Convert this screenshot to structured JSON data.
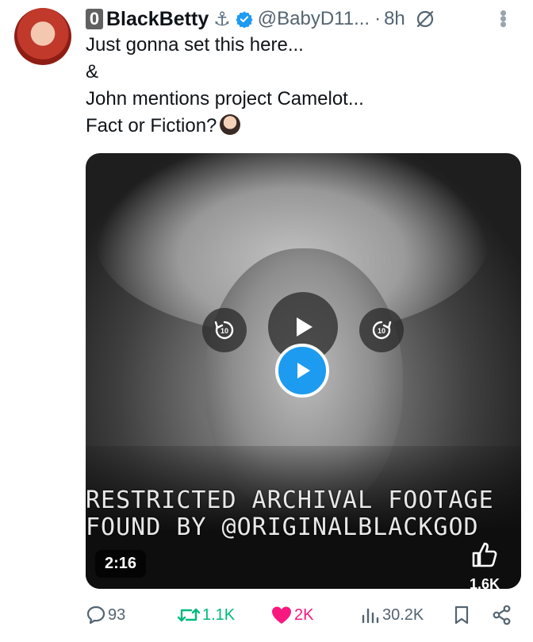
{
  "tweet": {
    "user": {
      "badge": "0",
      "display_name": "BlackBetty",
      "anchor_emoji": "⚓",
      "handle": "@BabyD11...",
      "separator": "·",
      "time": "8h"
    },
    "text_lines": [
      "Just gonna set this here...",
      "&",
      "John mentions project Camelot...",
      "Fact or Fiction?"
    ],
    "media": {
      "caption_line1": "RESTRICTED ARCHIVAL FOOTAGE",
      "caption_line2": "FOUND BY @ORIGINALBLACKGOD",
      "duration": "2:16",
      "like_count": "1.6K"
    },
    "actions": {
      "replies": "93",
      "reposts": "1.1K",
      "likes": "2K",
      "views": "30.2K"
    }
  },
  "colors": {
    "accent": "#1d9bf0",
    "like": "#f91880",
    "repost": "#00ba7c",
    "muted": "#536471"
  },
  "icons": {
    "verified": "verified-check-icon",
    "no_edit": "no-edit-icon",
    "more": "more-dots-icon",
    "rewind": "rewind-10-icon",
    "forward": "forward-10-icon",
    "play": "play-icon",
    "reply": "reply-icon",
    "repost": "repost-icon",
    "like": "heart-icon",
    "views": "views-icon",
    "bookmark": "bookmark-icon",
    "share": "share-icon",
    "thumb": "thumbs-up-icon"
  }
}
